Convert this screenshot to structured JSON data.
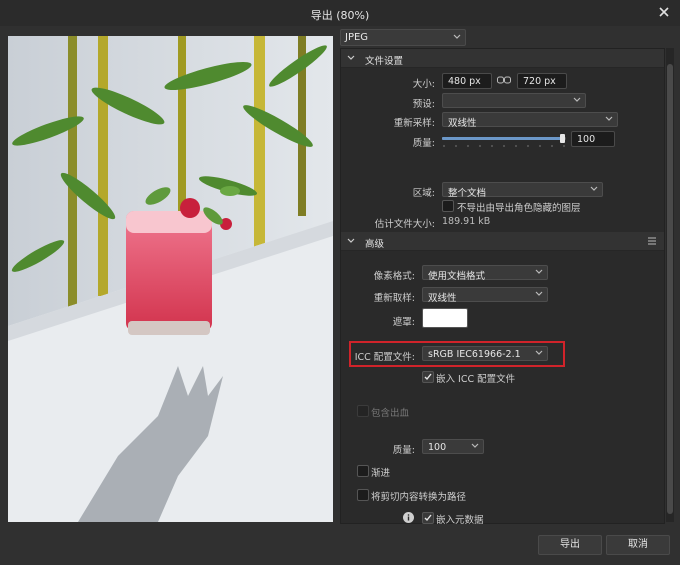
{
  "window": {
    "title": "导出 (80%)"
  },
  "format": {
    "selected": "JPEG"
  },
  "file_settings": {
    "header": "文件设置",
    "size_label": "大小:",
    "width": "480 px",
    "height": "720 px",
    "preset_label": "预设:",
    "preset_value": "",
    "resample_label": "重新采样:",
    "resample_value": "双线性",
    "quality_label": "质量:",
    "quality_value": "100",
    "quality_fraction": 1.0,
    "area_label": "区域:",
    "area_value": "整个文档",
    "no_hidden_label": "不导出由导出角色隐藏的图层",
    "estimate_label": "估计文件大小:",
    "estimate_value": "189.91 kB"
  },
  "advanced": {
    "header": "高级",
    "pixel_format_label": "像素格式:",
    "pixel_format_value": "使用文档格式",
    "resample_label": "重新取样:",
    "resample_value": "双线性",
    "matte_label": "遮罩:",
    "icc_label": "ICC 配置文件:",
    "icc_value": "sRGB IEC61966-2.1",
    "embed_icc_label": "嵌入 ICC 配置文件",
    "include_bleed_label": "包含出血",
    "quality_label": "质量:",
    "quality_value": "100",
    "progressive_label": "渐进",
    "convert_clip_label": "将剪切内容转换为路径",
    "embed_meta_label": "嵌入元数据"
  },
  "buttons": {
    "export": "导出",
    "cancel": "取消"
  },
  "colors": {
    "highlight": "#d0232a",
    "slider_fill": "#6b97c8"
  }
}
